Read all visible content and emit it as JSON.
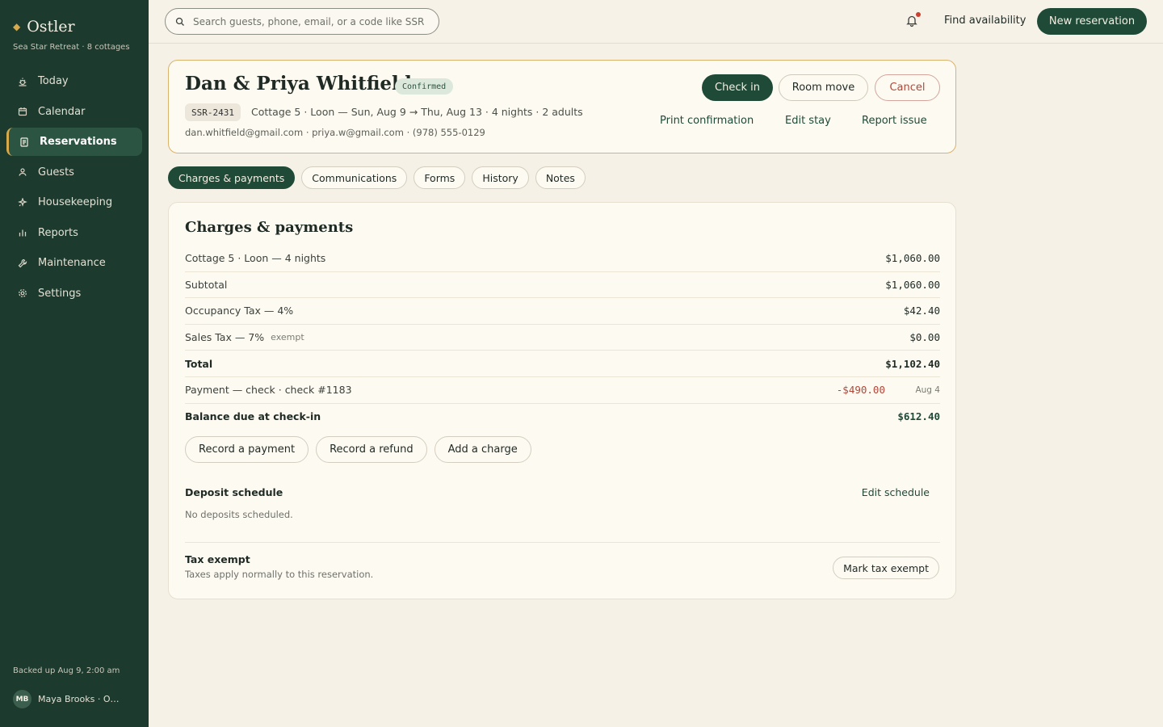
{
  "brand": {
    "name": "Ostler",
    "property": "Sea Star Retreat · 8 cottages",
    "mark_icon": "diamond-icon"
  },
  "sidebar": {
    "items": [
      {
        "label": "Today",
        "icon": "sun-icon",
        "active": false
      },
      {
        "label": "Calendar",
        "icon": "calendar-icon",
        "active": false
      },
      {
        "label": "Reservations",
        "icon": "document-icon",
        "active": true
      },
      {
        "label": "Guests",
        "icon": "person-icon",
        "active": false
      },
      {
        "label": "Housekeeping",
        "icon": "sparkle-icon",
        "active": false
      },
      {
        "label": "Reports",
        "icon": "bar-chart-icon",
        "active": false
      },
      {
        "label": "Maintenance",
        "icon": "wrench-icon",
        "active": false
      },
      {
        "label": "Settings",
        "icon": "gear-icon",
        "active": false
      }
    ],
    "backup_status": "Backed up Aug 9, 2:00 am",
    "user": {
      "initials": "MB",
      "name": "Maya Brooks · Ow…"
    }
  },
  "topbar": {
    "search_placeholder": "Search guests, phone, email, or a code like SSR",
    "find_availability": "Find availability",
    "new_reservation": "New reservation"
  },
  "reservation": {
    "guest_name": "Dan & Priya Whitfield",
    "status": "Confirmed",
    "code": "SSR-2431",
    "stay_summary": "Cottage 5 · Loon — Sun, Aug 9 → Thu, Aug 13 · 4 nights · 2 adults",
    "contact": "dan.whitfield@gmail.com · priya.w@gmail.com · (978) 555-0129",
    "actions": {
      "check_in": "Check in",
      "room_move": "Room move",
      "cancel": "Cancel",
      "print_confirmation": "Print confirmation",
      "edit_stay": "Edit stay",
      "report_issue": "Report issue"
    }
  },
  "tabs": [
    {
      "label": "Charges & payments",
      "active": true
    },
    {
      "label": "Communications",
      "active": false
    },
    {
      "label": "Forms",
      "active": false
    },
    {
      "label": "History",
      "active": false
    },
    {
      "label": "Notes",
      "active": false
    }
  ],
  "charges": {
    "title": "Charges & payments",
    "rows": [
      {
        "label": "Cottage 5 · Loon — 4 nights",
        "amount": "$1,060.00"
      },
      {
        "label": "Subtotal",
        "amount": "$1,060.00"
      },
      {
        "label": "Occupancy Tax — 4%",
        "amount": "$42.40"
      },
      {
        "label": "Sales Tax — 7%",
        "note": "exempt",
        "amount": "$0.00"
      },
      {
        "label": "Total",
        "amount": "$1,102.40"
      },
      {
        "label": "Payment — check · check #1183",
        "amount": "-$490.00",
        "date": "Aug 4"
      },
      {
        "label": "Balance due at check-in",
        "amount": "$612.40"
      }
    ],
    "buttons": {
      "record_payment": "Record a payment",
      "record_refund": "Record a refund",
      "add_charge": "Add a charge"
    },
    "deposit": {
      "title": "Deposit schedule",
      "edit": "Edit schedule",
      "empty": "No deposits scheduled."
    },
    "tax_exempt": {
      "title": "Tax exempt",
      "subtitle": "Taxes apply normally to this reservation.",
      "button": "Mark tax exempt"
    }
  },
  "colors": {
    "sidebar_bg": "#1c3a2e",
    "accent": "#1f4a37",
    "gold": "#d6a94a",
    "danger": "#b0483a"
  }
}
